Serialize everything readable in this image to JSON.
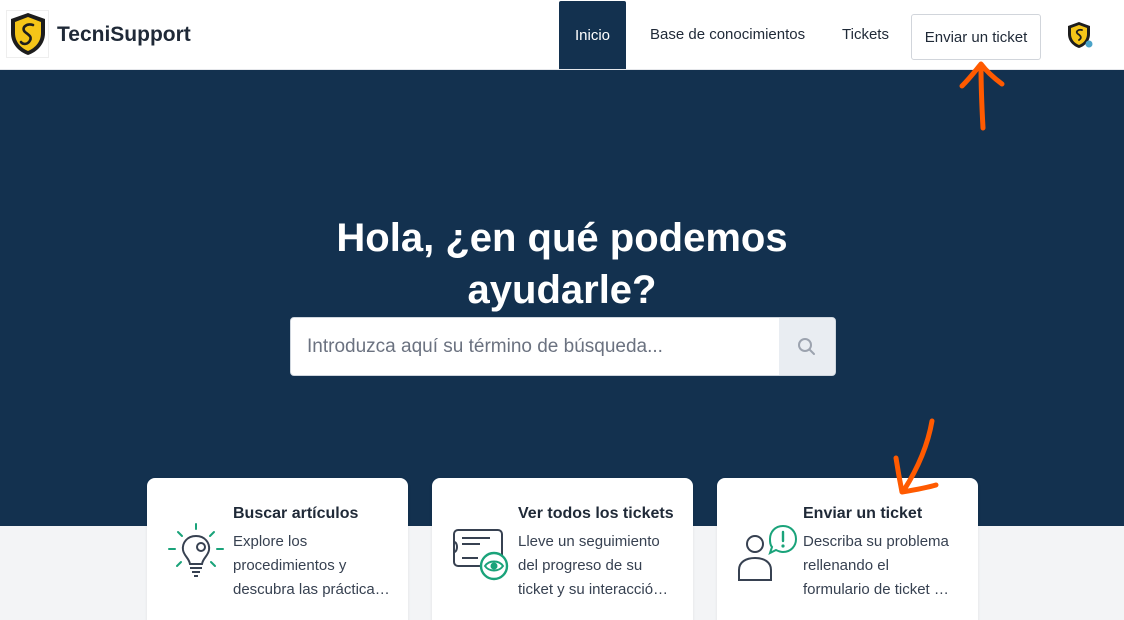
{
  "header": {
    "brand": "TecniSupport",
    "nav": {
      "home": "Inicio",
      "knowledge_base": "Base de conocimientos",
      "tickets": "Tickets",
      "submit_ticket": "Enviar un ticket"
    }
  },
  "hero": {
    "title_line1": "Hola, ¿en qué podemos",
    "title_line2": "ayudarle?",
    "search_placeholder": "Introduzca aquí su término de búsqueda..."
  },
  "cards": [
    {
      "title": "Buscar artículos",
      "desc_l1": "Explore los",
      "desc_l2": "procedimientos y",
      "desc_l3": "descubra las práctica…",
      "icon": "lightbulb-icon"
    },
    {
      "title": "Ver todos los tickets",
      "desc_l1": "Lleve un seguimiento",
      "desc_l2": "del progreso de su",
      "desc_l3": "ticket y su interacció…",
      "icon": "ticket-eye-icon"
    },
    {
      "title": "Enviar un ticket",
      "desc_l1": "Describa su problema",
      "desc_l2": "rellenando el",
      "desc_l3": "formulario de ticket …",
      "icon": "user-alert-icon"
    }
  ],
  "colors": {
    "hero_bg": "#13314f",
    "accent_green": "#1aa37a",
    "annotation_orange": "#ff5a00"
  }
}
